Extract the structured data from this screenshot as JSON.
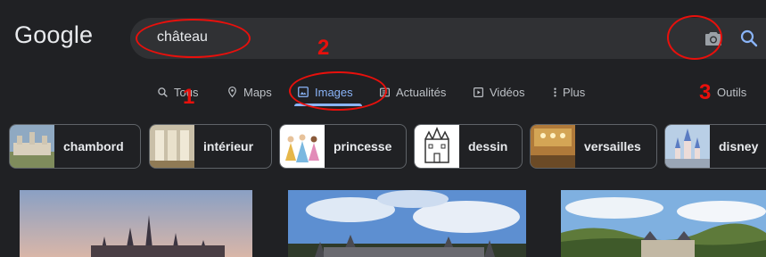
{
  "header": {
    "logo_text": "Google",
    "search_value": "château"
  },
  "tabs": [
    {
      "label": "Tous",
      "icon": "search-icon"
    },
    {
      "label": "Maps",
      "icon": "map-pin-icon"
    },
    {
      "label": "Images",
      "icon": "image-icon",
      "active": true
    },
    {
      "label": "Actualités",
      "icon": "news-icon"
    },
    {
      "label": "Vidéos",
      "icon": "play-icon"
    },
    {
      "label": "Plus",
      "icon": "more-vert-icon"
    }
  ],
  "tools_label": "Outils",
  "chips": [
    {
      "label": "chambord"
    },
    {
      "label": "intérieur"
    },
    {
      "label": "princesse"
    },
    {
      "label": "dessin"
    },
    {
      "label": "versailles"
    },
    {
      "label": "disney"
    }
  ],
  "annotations": {
    "n1": "1",
    "n2": "2",
    "n3": "3"
  },
  "colors": {
    "background": "#202124",
    "search_bg": "#303134",
    "accent": "#8ab4f8",
    "annotation": "#e8100c"
  }
}
